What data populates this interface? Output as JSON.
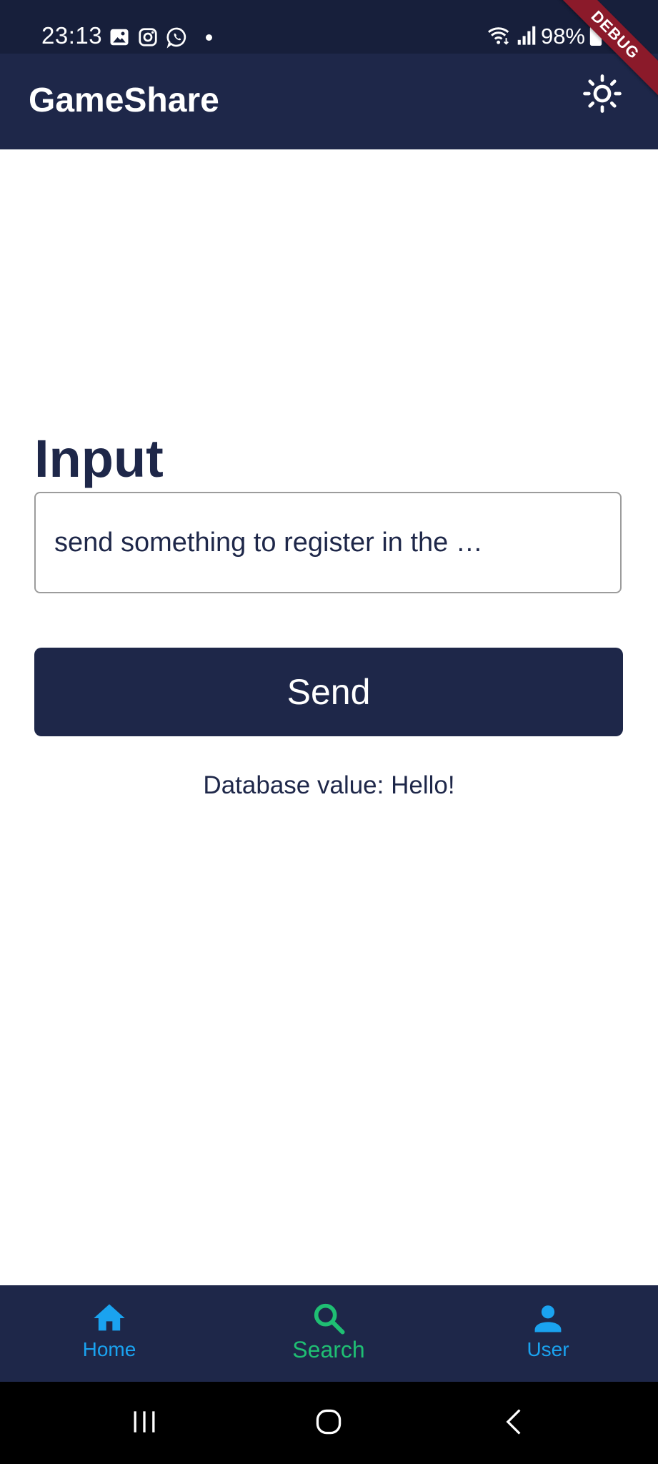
{
  "status_bar": {
    "time": "23:13",
    "battery": "98%",
    "icons_left": [
      "gallery-icon",
      "instagram-icon",
      "whatsapp-icon",
      "notification-dot"
    ],
    "icons_right": [
      "wifi-icon",
      "signal-icon",
      "battery-icon"
    ]
  },
  "debug_banner": {
    "label": "DEBUG",
    "color": "#8b1a2a"
  },
  "app_bar": {
    "title": "GameShare",
    "action_icon": "sun-icon"
  },
  "form": {
    "heading": "Input",
    "field_placeholder": "send something to register in the …",
    "send_label": "Send",
    "db_value_text": "Database value: Hello!"
  },
  "bottom_nav": {
    "items": [
      {
        "label": "Home",
        "icon": "home-icon",
        "color": "#1aa3f0"
      },
      {
        "label": "Search",
        "icon": "search-icon",
        "color": "#1fbf73",
        "selected": true
      },
      {
        "label": "User",
        "icon": "user-icon",
        "color": "#1aa3f0"
      }
    ]
  },
  "system_nav": {
    "buttons": [
      "recents-icon",
      "home-circle-icon",
      "back-icon"
    ]
  },
  "colors": {
    "primary": "#1e2749",
    "status_bar": "#171f3b",
    "accent": "#1aa3f0",
    "selected": "#1fbf73"
  }
}
